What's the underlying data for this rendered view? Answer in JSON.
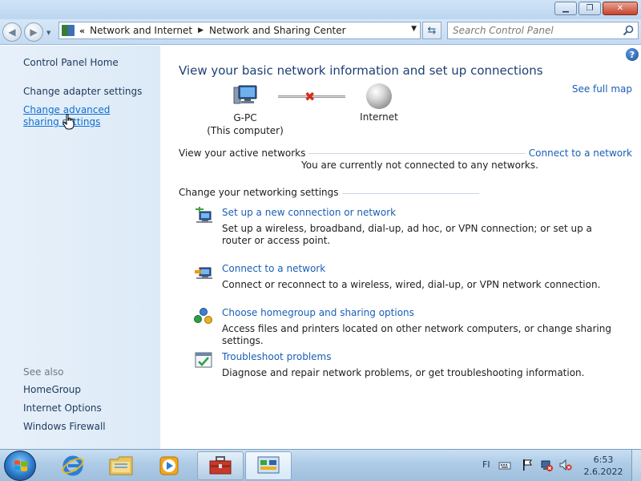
{
  "window": {
    "minimize": "▁",
    "maximize": "❐",
    "close": "✕"
  },
  "address": {
    "prefix": "«",
    "crumbs": [
      "Network and Internet",
      "Network and Sharing Center"
    ],
    "separator": "▶",
    "dropdown": "▼",
    "refresh": "⇆"
  },
  "search": {
    "placeholder": "Search Control Panel"
  },
  "sidebar": {
    "items": [
      {
        "label": "Control Panel Home"
      },
      {
        "label": "Change adapter settings"
      },
      {
        "label": "Change advanced sharing settings"
      }
    ],
    "see_also_title": "See also",
    "see_also": [
      {
        "label": "HomeGroup"
      },
      {
        "label": "Internet Options"
      },
      {
        "label": "Windows Firewall"
      }
    ]
  },
  "main": {
    "heading": "View your basic network information and set up connections",
    "see_full_map": "See full map",
    "help": "?",
    "map": {
      "computer_name": "G-PC",
      "computer_sub": "(This computer)",
      "internet": "Internet",
      "disconnected_mark": "✖"
    },
    "active_networks": {
      "title": "View your active networks",
      "connect_link": "Connect to a network",
      "status": "You are currently not connected to any networks."
    },
    "settings": {
      "title": "Change your networking settings",
      "tasks": [
        {
          "title": "Set up a new connection or network",
          "desc": "Set up a wireless, broadband, dial-up, ad hoc, or VPN connection; or set up a router or access point.",
          "icon": "new-connection-icon"
        },
        {
          "title": "Connect to a network",
          "desc": "Connect or reconnect to a wireless, wired, dial-up, or VPN network connection.",
          "icon": "connect-network-icon"
        },
        {
          "title": "Choose homegroup and sharing options",
          "desc": "Access files and printers located on other network computers, or change sharing settings.",
          "icon": "homegroup-icon"
        },
        {
          "title": "Troubleshoot problems",
          "desc": "Diagnose and repair network problems, or get troubleshooting information.",
          "icon": "troubleshoot-icon"
        }
      ]
    }
  },
  "taskbar": {
    "language": "FI",
    "time": "6:53",
    "date": "2.6.2022"
  },
  "colors": {
    "link": "#1a5fb4",
    "heading": "#1e3f74",
    "sidebar_bg": "#e2eef9",
    "error_x": "#d62b1e"
  }
}
